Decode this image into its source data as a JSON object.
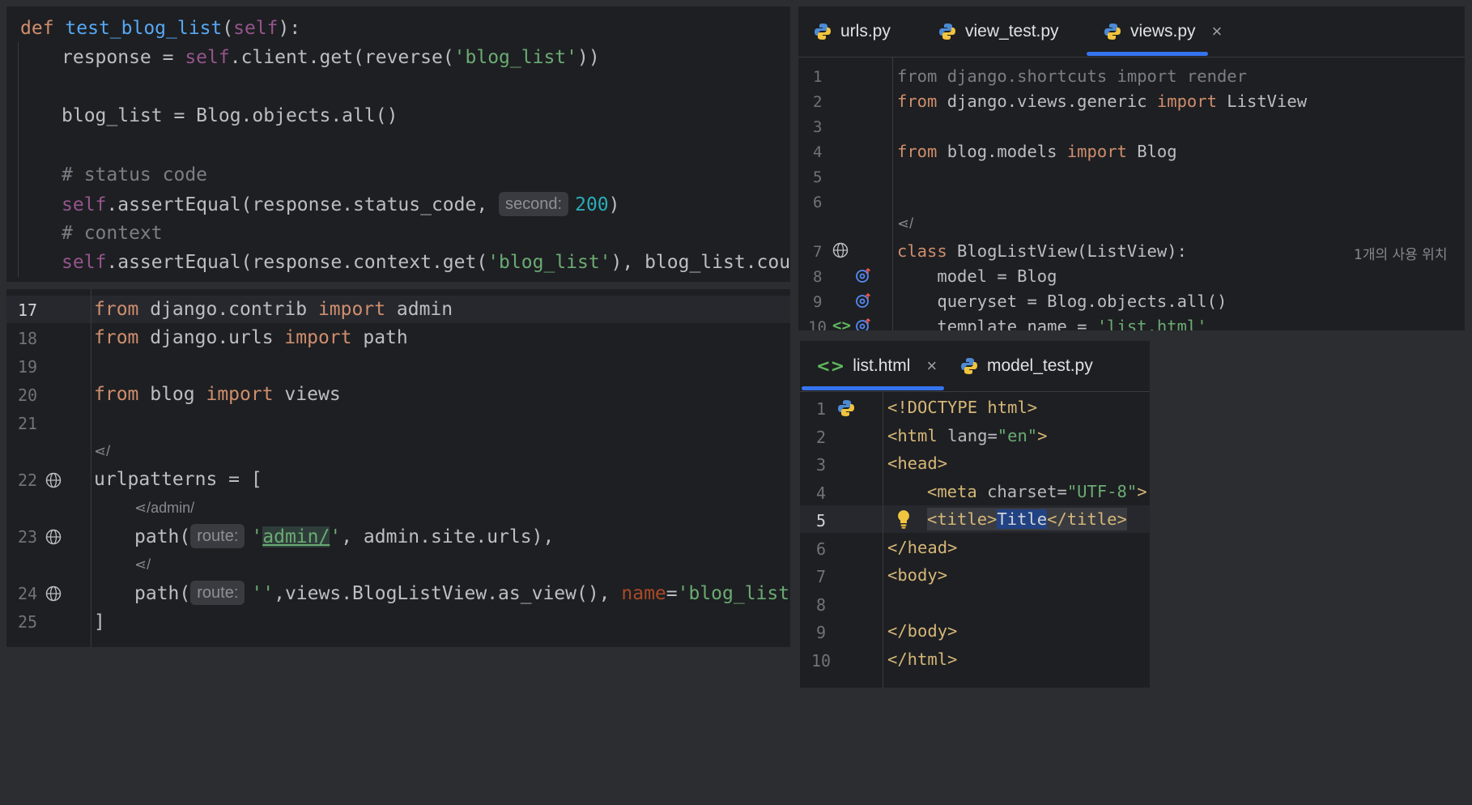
{
  "test_panel": {
    "lines": {
      "def": "def",
      "fn_name": "test_blog_list",
      "self_param": "self",
      "l1_a": "response = ",
      "l1_self": "self",
      "l1_b": ".client.get(reverse(",
      "l1_str": "'blog_list'",
      "l1_c": "))",
      "l2": "blog_list = Blog.objects.all()",
      "c1": "# status code",
      "l3_self": "self",
      "l3_a": ".assertEqual(response.status_code, ",
      "l3_hint": "second:",
      "l3_num": "200",
      "l3_b": ")",
      "c2": "# context",
      "l4_self": "self",
      "l4_a": ".assertEqual(response.context.get(",
      "l4_str": "'blog_list'",
      "l4_b": "), blog_list.count())"
    }
  },
  "urls_panel": {
    "line_numbers": [
      "17",
      "18",
      "19",
      "20",
      "21",
      "22",
      "23",
      "24",
      "25"
    ],
    "l17_kw1": "from",
    "l17_a": " django.contrib ",
    "l17_kw2": "import",
    "l17_b": " admin",
    "l18_kw1": "from",
    "l18_a": " django.urls ",
    "l18_kw2": "import",
    "l18_b": " path",
    "l20_kw1": "from",
    "l20_a": " blog ",
    "l20_kw2": "import",
    "l20_b": " views",
    "hint_root": "/",
    "l22": "urlpatterns = [",
    "hint_admin": "/admin/",
    "l23_a": "path(",
    "l23_hint": "route:",
    "l23_str_q1": "'",
    "l23_str_link": "admin/",
    "l23_str_q2": "'",
    "l23_b": ", admin.site.urls),",
    "hint_root2": "/",
    "l24_a": "path(",
    "l24_hint": "route:",
    "l24_str": "''",
    "l24_b": ",views.BlogListView.as_view(), ",
    "l24_param": "name",
    "l24_eq": "=",
    "l24_str2": "'blog_list'",
    "l24_c": "),",
    "l25": "]"
  },
  "views_panel": {
    "tabs": [
      {
        "label": "urls.py"
      },
      {
        "label": "view_test.py"
      },
      {
        "label": "views.py",
        "active": true
      }
    ],
    "close": "×",
    "line_numbers": [
      "1",
      "2",
      "3",
      "4",
      "5",
      "6",
      "7",
      "8",
      "9",
      "10"
    ],
    "l1": "from django.shortcuts import render",
    "l2_kw1": "from",
    "l2_a": " django.views.generic ",
    "l2_kw2": "import",
    "l2_b": " ListView",
    "l4_kw1": "from",
    "l4_a": " blog.models ",
    "l4_kw2": "import",
    "l4_b": " Blog",
    "hint_root": "/",
    "l7_kw": "class",
    "l7_a": " BlogListView(ListView):",
    "l7_usage": "1개의 사용 위치",
    "l8": "    model = Blog",
    "l9": "    queryset = Blog.objects.all()",
    "l10_a": "    template_name = ",
    "l10_str": "'list.html'"
  },
  "html_panel": {
    "tabs": [
      {
        "label": "list.html",
        "active": true
      },
      {
        "label": "model_test.py"
      }
    ],
    "close": "×",
    "line_numbers": [
      "1",
      "2",
      "3",
      "4",
      "5",
      "6",
      "7",
      "8",
      "9",
      "10"
    ],
    "l1": "<!DOCTYPE html>",
    "l2_a": "<html ",
    "l2_attr": "lang",
    "l2_eq": "=",
    "l2_str": "\"en\"",
    "l2_b": ">",
    "l3": "<head>",
    "l4_a": "<meta ",
    "l4_attr": "charset",
    "l4_eq": "=",
    "l4_str": "\"UTF-8\"",
    "l4_b": ">",
    "l5_a": "<title>",
    "l5_sel": "Title",
    "l5_b": "</title>",
    "l6": "</head>",
    "l7": "<body>",
    "l9": "</body>",
    "l10": "</html>"
  },
  "colors": {
    "background": "#2b2d30",
    "editor": "#1e1f22",
    "accent": "#3574f0",
    "keyword": "#cf8e6d",
    "string": "#6aab73",
    "function": "#56a8f5",
    "self": "#94558d",
    "number": "#2aacb8"
  }
}
